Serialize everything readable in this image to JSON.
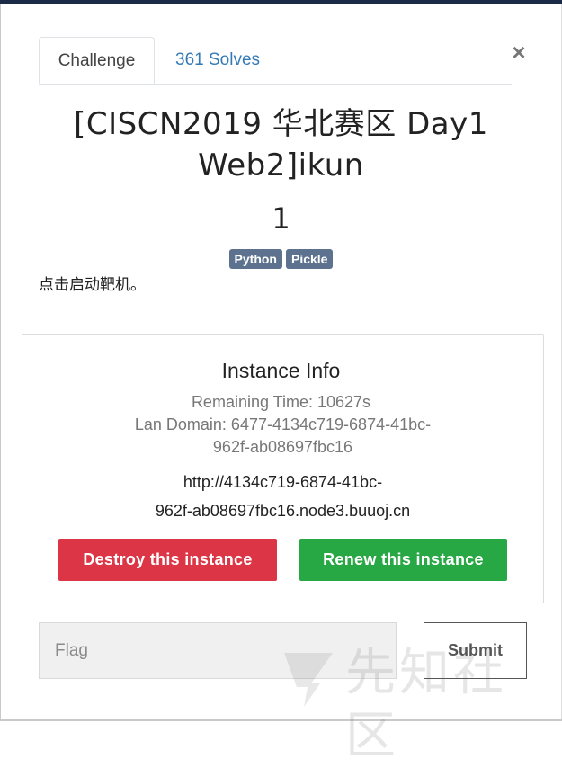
{
  "tabs": {
    "challenge_label": "Challenge",
    "solves_label": "361 Solves"
  },
  "close_symbol": "×",
  "challenge": {
    "title_line1": "[CISCN2019 华北赛区 Day1",
    "title_line2": "Web2]ikun",
    "points": "1",
    "tags": [
      "Python",
      "Pickle"
    ],
    "description": "点击启动靶机。"
  },
  "instance": {
    "heading": "Instance Info",
    "remaining_time": "Remaining Time: 10627s",
    "lan_domain_line1": "Lan Domain: 6477-4134c719-6874-41bc-",
    "lan_domain_line2": "962f-ab08697fbc16",
    "url_line1": "http://4134c719-6874-41bc-",
    "url_line2": "962f-ab08697fbc16.node3.buuoj.cn",
    "destroy_label": "Destroy this instance",
    "renew_label": "Renew this instance"
  },
  "flag_form": {
    "placeholder": "Flag",
    "value": "",
    "submit_label": "Submit"
  },
  "watermark_text": "先知社区",
  "colors": {
    "destroy": "#dc3545",
    "renew": "#28a745",
    "tag": "#5c728f",
    "link": "#337ab7"
  }
}
